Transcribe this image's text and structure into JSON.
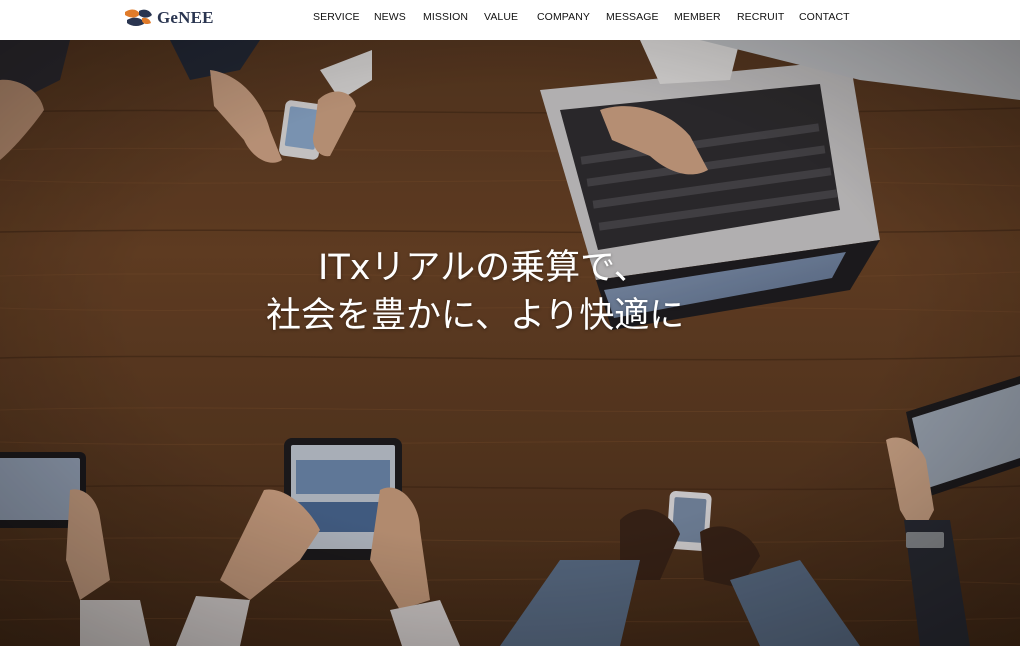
{
  "brand": {
    "name": "GeNEE"
  },
  "nav": {
    "items": [
      "SERVICE",
      "NEWS",
      "MISSION",
      "VALUE",
      "COMPANY",
      "MESSAGE",
      "MEMBER",
      "RECRUIT",
      "CONTACT"
    ]
  },
  "hero": {
    "headline_line1": "ITxリアルの乗算で、",
    "headline_line2": "社会を豊かに、より快適に"
  },
  "colors": {
    "header_bg": "#ffffff",
    "nav_text": "#111111",
    "logo_orange": "#e07b2a",
    "logo_navy": "#2a3550",
    "hero_text": "#ffffff",
    "wood": "#6b4426"
  }
}
